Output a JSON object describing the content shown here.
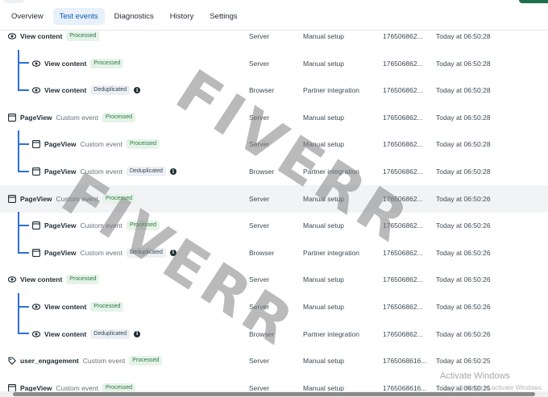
{
  "tabs": [
    {
      "label": "Overview",
      "active": false
    },
    {
      "label": "Test events",
      "active": true
    },
    {
      "label": "Diagnostics",
      "active": false
    },
    {
      "label": "History",
      "active": false
    },
    {
      "label": "Settings",
      "active": false
    }
  ],
  "events": [
    {
      "icon": "eye-icon",
      "name": "View content",
      "sub": "",
      "badge": "Processed",
      "badge_type": "processed",
      "info": false,
      "source": "Server",
      "method": "Manual setup",
      "id": "176506862...",
      "time": "Today at 06:50:28",
      "level": 0
    },
    {
      "icon": "eye-icon",
      "name": "View content",
      "sub": "",
      "badge": "Processed",
      "badge_type": "processed",
      "info": false,
      "source": "Server",
      "method": "Manual setup",
      "id": "176506862...",
      "time": "Today at 06:50:28",
      "level": 1
    },
    {
      "icon": "eye-icon",
      "name": "View content",
      "sub": "",
      "badge": "Deduplicated",
      "badge_type": "dedup",
      "info": true,
      "source": "Browser",
      "method": "Partner integration",
      "id": "176506862...",
      "time": "Today at 06:50:28",
      "level": 1
    },
    {
      "icon": "browser-window-icon",
      "name": "PageView",
      "sub": "Custom event",
      "badge": "Processed",
      "badge_type": "processed",
      "info": false,
      "source": "Server",
      "method": "Manual setup",
      "id": "176506862...",
      "time": "Today at 06:50:28",
      "level": 0
    },
    {
      "icon": "browser-window-icon",
      "name": "PageView",
      "sub": "Custom event",
      "badge": "Processed",
      "badge_type": "processed",
      "info": false,
      "source": "Server",
      "method": "Manual setup",
      "id": "176506862...",
      "time": "Today at 06:50:28",
      "level": 1
    },
    {
      "icon": "browser-window-icon",
      "name": "PageView",
      "sub": "Custom event",
      "badge": "Deduplicated",
      "badge_type": "dedup",
      "info": true,
      "source": "Browser",
      "method": "Partner integration",
      "id": "176506862...",
      "time": "Today at 06:50:28",
      "level": 1
    },
    {
      "icon": "browser-window-icon",
      "name": "PageView",
      "sub": "Custom event",
      "badge": "Processed",
      "badge_type": "processed",
      "info": false,
      "source": "Server",
      "method": "Manual setup",
      "id": "176506862...",
      "time": "Today at 06:50:26",
      "level": 0,
      "highlight": true
    },
    {
      "icon": "browser-window-icon",
      "name": "PageView",
      "sub": "Custom event",
      "badge": "Processed",
      "badge_type": "processed",
      "info": false,
      "source": "Server",
      "method": "Manual setup",
      "id": "176506862...",
      "time": "Today at 06:50:26",
      "level": 1
    },
    {
      "icon": "browser-window-icon",
      "name": "PageView",
      "sub": "Custom event",
      "badge": "Deduplicated",
      "badge_type": "dedup",
      "info": true,
      "source": "Browser",
      "method": "Partner integration",
      "id": "176506862...",
      "time": "Today at 06:50:26",
      "level": 1
    },
    {
      "icon": "eye-icon",
      "name": "View content",
      "sub": "",
      "badge": "Processed",
      "badge_type": "processed",
      "info": false,
      "source": "Server",
      "method": "Manual setup",
      "id": "176506862...",
      "time": "Today at 06:50:26",
      "level": 0
    },
    {
      "icon": "eye-icon",
      "name": "View content",
      "sub": "",
      "badge": "Processed",
      "badge_type": "processed",
      "info": false,
      "source": "Server",
      "method": "Manual setup",
      "id": "176506862...",
      "time": "Today at 06:50:26",
      "level": 1
    },
    {
      "icon": "eye-icon",
      "name": "View content",
      "sub": "",
      "badge": "Deduplicated",
      "badge_type": "dedup",
      "info": true,
      "source": "Browser",
      "method": "Partner integration",
      "id": "176506862...",
      "time": "Today at 06:50:26",
      "level": 1
    },
    {
      "icon": "tag-icon",
      "name": "user_engagement",
      "sub": "Custom event",
      "badge": "Processed",
      "badge_type": "processed",
      "info": false,
      "source": "Server",
      "method": "Manual setup",
      "id": "1765068616...",
      "time": "Today at 06:50:25",
      "level": 0
    },
    {
      "icon": "browser-window-icon",
      "name": "PageView",
      "sub": "Custom event",
      "badge": "Processed",
      "badge_type": "processed",
      "info": false,
      "source": "Server",
      "method": "Manual setup",
      "id": "1765068616...",
      "time": "Today at 06:50:25",
      "level": 0
    }
  ],
  "watermarks": [
    "FIVERR",
    "FIVERR"
  ],
  "os_overlay": {
    "title": "Activate Windows",
    "subtitle": "Go to Settings to activate Windows."
  },
  "colors": {
    "accent": "#0a5ab8",
    "tree_line": "#2d6fd6",
    "processed_bg": "#e5f3e8",
    "processed_text": "#28783f",
    "brand_button": "#1e6f4d"
  }
}
